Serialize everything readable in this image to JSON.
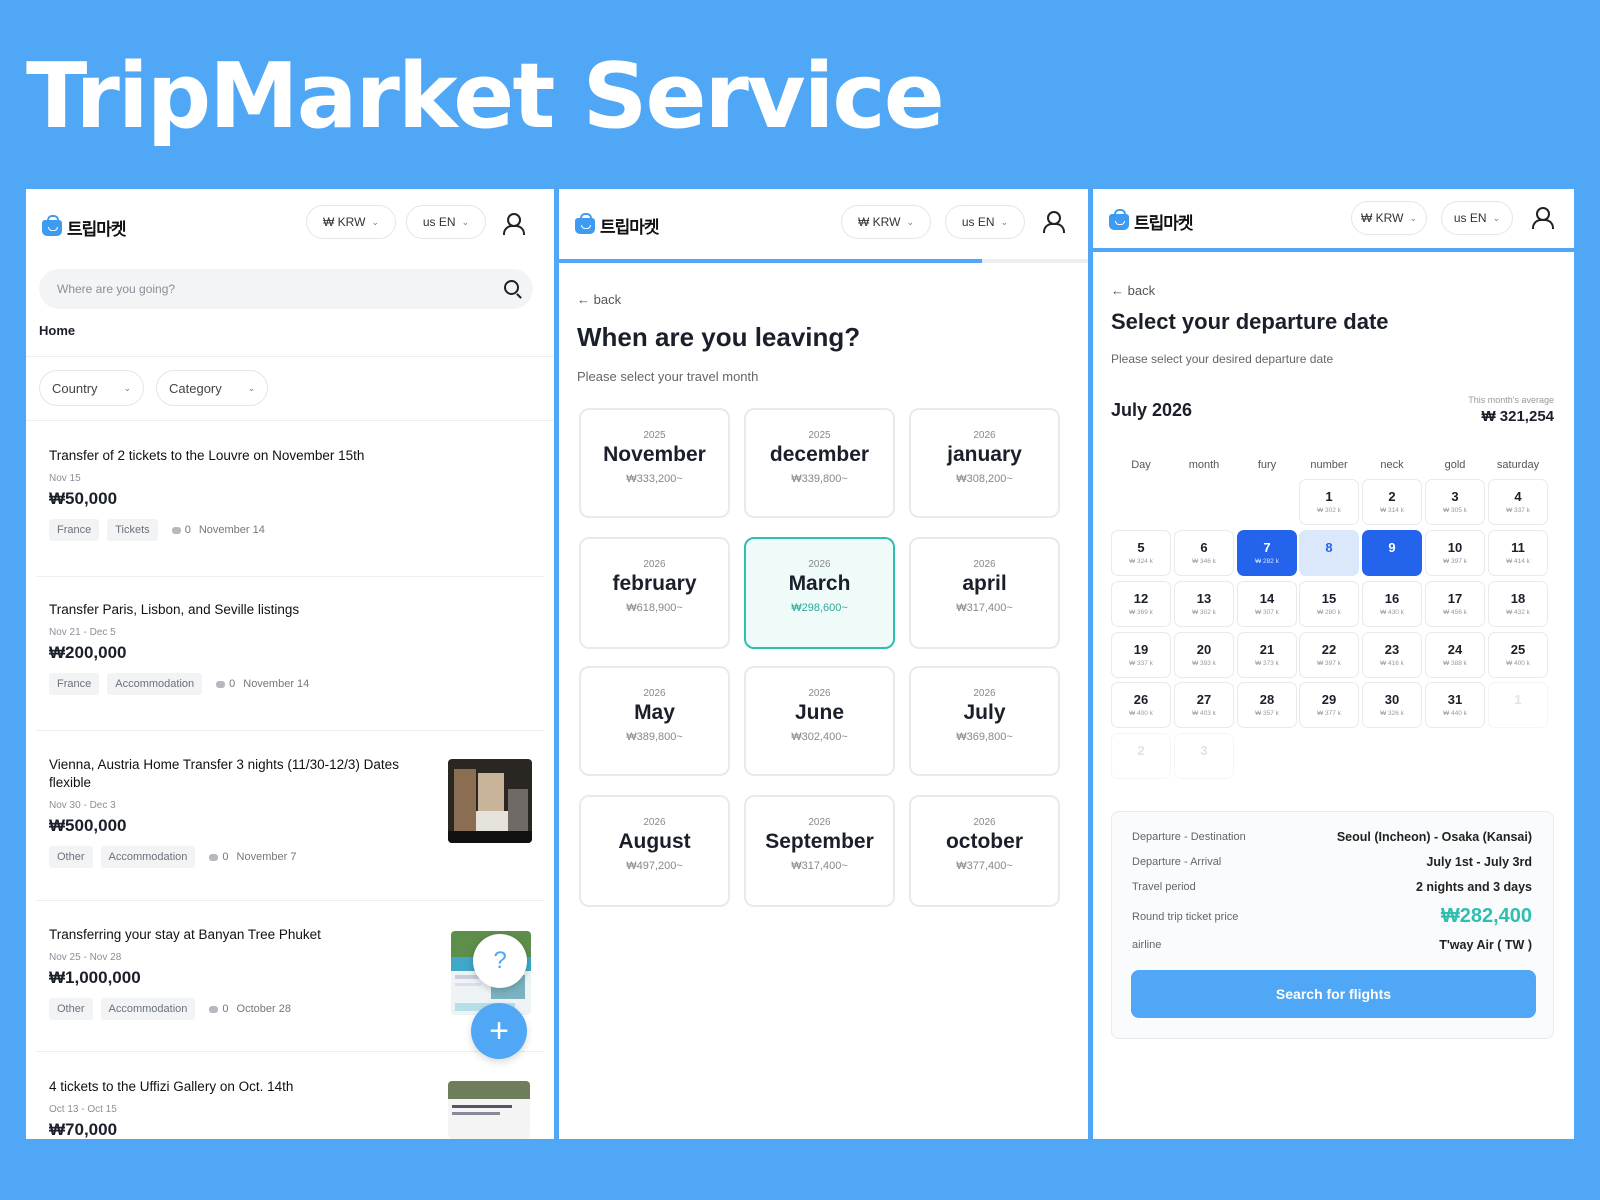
{
  "title": "TripMarket Service",
  "brand": {
    "logo_text": "트립마켓",
    "accent": "#4fa7f5",
    "teal": "#2fbfb0",
    "selected_blue": "#2463eb"
  },
  "header": {
    "currency": "₩  KRW",
    "language": "us  EN"
  },
  "list_screen": {
    "search_placeholder": "Where are you going?",
    "home_label": "Home",
    "filters": [
      "Country",
      "Category"
    ],
    "posts": [
      {
        "title": "Transfer of 2 tickets to the Louvre on November 15th",
        "date": "Nov 15",
        "price": "₩50,000",
        "tags": [
          "France",
          "Tickets"
        ],
        "comments": "0",
        "posted": "November 14"
      },
      {
        "title": "Transfer Paris, Lisbon, and Seville listings",
        "date": "Nov 21 - Dec 5",
        "price": "₩200,000",
        "tags": [
          "France",
          "Accommodation"
        ],
        "comments": "0",
        "posted": "November 14"
      },
      {
        "title": "Vienna, Austria Home Transfer 3 nights (11/30-12/3) Dates flexible",
        "date": "Nov 30 - Dec 3",
        "price": "₩500,000",
        "tags": [
          "Other",
          "Accommodation"
        ],
        "comments": "0",
        "posted": "November 7"
      },
      {
        "title": "Transferring your stay at Banyan Tree Phuket",
        "date": "Nov 25 - Nov 28",
        "price": "₩1,000,000",
        "tags": [
          "Other",
          "Accommodation"
        ],
        "comments": "0",
        "posted": "October 28"
      },
      {
        "title": "4 tickets to the Uffizi Gallery on Oct. 14th",
        "date": "Oct 13 - Oct 15",
        "price": "₩70,000",
        "tags": [],
        "comments": "",
        "posted": ""
      }
    ],
    "help_fab": "?",
    "add_fab": "+"
  },
  "month_screen": {
    "back": "back",
    "heading": "When are you leaving?",
    "subheading": "Please select your travel month",
    "progress": 0.8,
    "months": [
      {
        "year": "2025",
        "name": "November",
        "price": "₩333,200~"
      },
      {
        "year": "2025",
        "name": "december",
        "price": "₩339,800~"
      },
      {
        "year": "2026",
        "name": "january",
        "price": "₩308,200~"
      },
      {
        "year": "2026",
        "name": "february",
        "price": "₩618,900~"
      },
      {
        "year": "2026",
        "name": "March",
        "price": "₩298,600~",
        "selected": true
      },
      {
        "year": "2026",
        "name": "april",
        "price": "₩317,400~"
      },
      {
        "year": "2026",
        "name": "May",
        "price": "₩389,800~"
      },
      {
        "year": "2026",
        "name": "June",
        "price": "₩302,400~"
      },
      {
        "year": "2026",
        "name": "July",
        "price": "₩369,800~"
      },
      {
        "year": "2026",
        "name": "August",
        "price": "₩497,200~"
      },
      {
        "year": "2026",
        "name": "September",
        "price": "₩317,400~"
      },
      {
        "year": "2026",
        "name": "october",
        "price": "₩377,400~"
      }
    ]
  },
  "date_screen": {
    "back": "back",
    "heading": "Select your departure date",
    "subheading": "Please select your desired departure date",
    "month_label": "July 2026",
    "average_label": "This month's average",
    "average_value": "₩ 321,254",
    "weekdays": [
      "Day",
      "month",
      "fury",
      "number",
      "neck",
      "gold",
      "saturday"
    ],
    "days": [
      {
        "d": "1",
        "p": "₩ 302 k"
      },
      {
        "d": "2",
        "p": "₩ 314 k"
      },
      {
        "d": "3",
        "p": "₩ 305 k"
      },
      {
        "d": "4",
        "p": "₩ 337 k"
      },
      {
        "d": "5",
        "p": "₩ 324 k"
      },
      {
        "d": "6",
        "p": "₩ 346 k"
      },
      {
        "d": "7",
        "p": "₩ 282 k",
        "state": "sel"
      },
      {
        "d": "8",
        "p": "",
        "state": "rng"
      },
      {
        "d": "9",
        "p": "",
        "state": "sel"
      },
      {
        "d": "10",
        "p": "₩ 397 k"
      },
      {
        "d": "11",
        "p": "₩ 414 k"
      },
      {
        "d": "12",
        "p": "₩ 369 k"
      },
      {
        "d": "13",
        "p": "₩ 302 k"
      },
      {
        "d": "14",
        "p": "₩ 307 k"
      },
      {
        "d": "15",
        "p": "₩ 280 k"
      },
      {
        "d": "16",
        "p": "₩ 430 k"
      },
      {
        "d": "17",
        "p": "₩ 456 k"
      },
      {
        "d": "18",
        "p": "₩ 432 k"
      },
      {
        "d": "19",
        "p": "₩ 337 k"
      },
      {
        "d": "20",
        "p": "₩ 393 k"
      },
      {
        "d": "21",
        "p": "₩ 373 k"
      },
      {
        "d": "22",
        "p": "₩ 397 k"
      },
      {
        "d": "23",
        "p": "₩ 416 k"
      },
      {
        "d": "24",
        "p": "₩ 388 k"
      },
      {
        "d": "25",
        "p": "₩ 400 k"
      },
      {
        "d": "26",
        "p": "₩ 400 k"
      },
      {
        "d": "27",
        "p": "₩ 403 k"
      },
      {
        "d": "28",
        "p": "₩ 357 k"
      },
      {
        "d": "29",
        "p": "₩ 377 k"
      },
      {
        "d": "30",
        "p": "₩ 326 k"
      },
      {
        "d": "31",
        "p": "₩ 440 k"
      },
      {
        "d": "1",
        "p": "",
        "state": "dim"
      },
      {
        "d": "2",
        "p": "",
        "state": "dim"
      },
      {
        "d": "3",
        "p": "",
        "state": "dim"
      }
    ],
    "summary": [
      {
        "k": "Departure - Destination",
        "v": "Seoul (Incheon) - Osaka (Kansai)"
      },
      {
        "k": "Departure - Arrival",
        "v": "July 1st - July 3rd"
      },
      {
        "k": "Travel period",
        "v": "2 nights and 3 days"
      },
      {
        "k": "Round trip ticket price",
        "v": "₩282,400",
        "big": true
      },
      {
        "k": "airline",
        "v": "T'way Air ( TW )"
      }
    ],
    "search_button": "Search for flights"
  }
}
